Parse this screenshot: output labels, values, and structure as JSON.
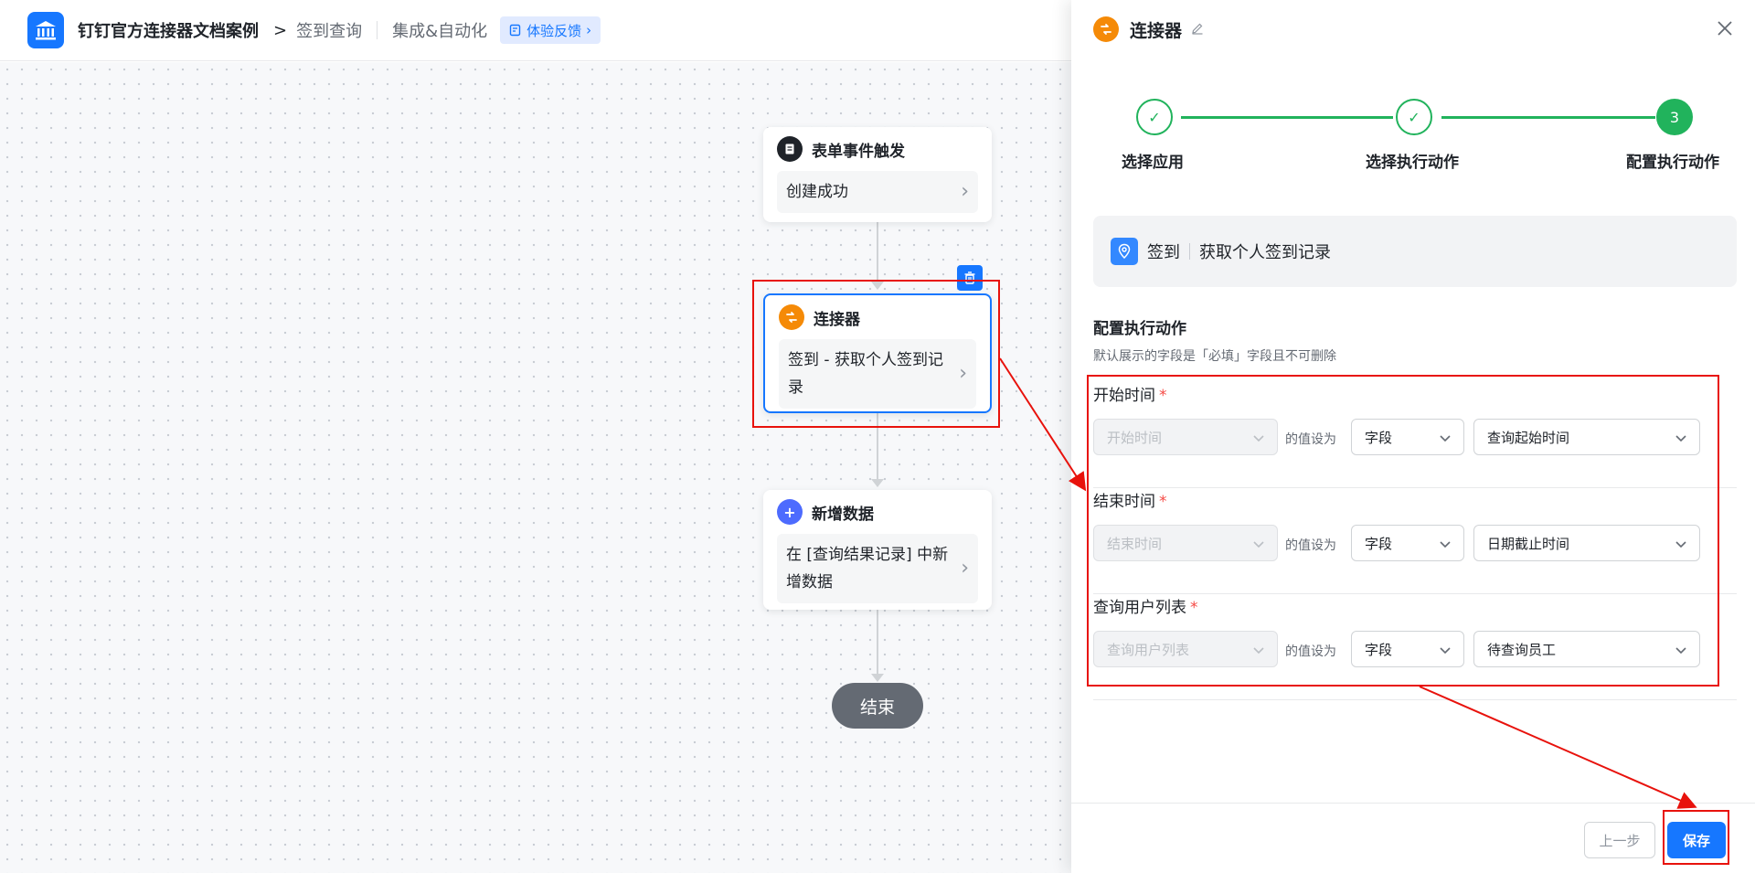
{
  "header": {
    "app_name": "钉钉官方连接器文档案例",
    "breadcrumb_sep": ">",
    "page": "签到查询",
    "section": "集成&自动化",
    "feedback": "体验反馈"
  },
  "flow": {
    "trigger": {
      "title": "表单事件触发",
      "body": "创建成功"
    },
    "connector": {
      "title": "连接器",
      "body": "签到 - 获取个人签到记录"
    },
    "add_data": {
      "title": "新增数据",
      "body": "在 [查询结果记录] 中新增数据"
    },
    "end": "结束"
  },
  "panel": {
    "title": "连接器",
    "steps": [
      {
        "label": "选择应用",
        "state": "done",
        "num": ""
      },
      {
        "label": "选择执行动作",
        "state": "done",
        "num": ""
      },
      {
        "label": "配置执行动作",
        "state": "active",
        "num": "3"
      }
    ],
    "app": {
      "name": "签到",
      "action": "获取个人签到记录"
    },
    "config_title": "配置执行动作",
    "config_note": "默认展示的字段是「必填」字段且不可删除",
    "set_as": "的值设为",
    "fields": [
      {
        "label": "开始时间",
        "required": "*",
        "param": "开始时间",
        "type": "字段",
        "value": "查询起始时间"
      },
      {
        "label": "结束时间",
        "required": "*",
        "param": "结束时间",
        "type": "字段",
        "value": "日期截止时间"
      },
      {
        "label": "查询用户列表",
        "required": "*",
        "param": "查询用户列表",
        "type": "字段",
        "value": "待查询员工"
      }
    ],
    "prev": "上一步",
    "save": "保存"
  },
  "colors": {
    "brand": "#1677ff",
    "success": "#21b35c",
    "annotation": "#e8120c",
    "connector_badge": "#f58a07",
    "add_badge": "#4d6bfe"
  }
}
